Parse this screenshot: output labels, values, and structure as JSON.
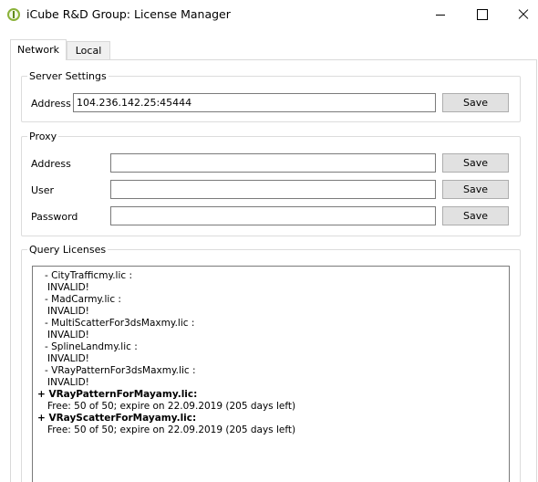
{
  "window": {
    "title": "iCube R&D Group: License Manager"
  },
  "tabs": [
    {
      "label": "Network",
      "active": true
    },
    {
      "label": "Local",
      "active": false
    }
  ],
  "server_settings": {
    "title": "Server Settings",
    "address_label": "Address",
    "address_value": "104.236.142.25:45444",
    "save_label": "Save"
  },
  "proxy": {
    "title": "Proxy",
    "address_label": "Address",
    "address_value": "",
    "user_label": "User",
    "user_value": "",
    "password_label": "Password",
    "password_value": "",
    "save_label": "Save"
  },
  "query_licenses": {
    "title": "Query Licenses",
    "entries": [
      {
        "prefix": "-",
        "name": "CityTrafficmy.lic :",
        "status": "INVALID!"
      },
      {
        "prefix": "-",
        "name": "MadCarmy.lic :",
        "status": "INVALID!"
      },
      {
        "prefix": "-",
        "name": "MultiScatterFor3dsMaxmy.lic :",
        "status": "INVALID!"
      },
      {
        "prefix": "-",
        "name": "SplineLandmy.lic :",
        "status": "INVALID!"
      },
      {
        "prefix": "-",
        "name": "VRayPatternFor3dsMaxmy.lic :",
        "status": "INVALID!"
      },
      {
        "prefix": "+",
        "name": "VRayPatternForMayamy.lic:",
        "status": "Free: 50 of 50; expire on 22.09.2019 (205 days left)"
      },
      {
        "prefix": "+",
        "name": "VRayScatterForMayamy.lic:",
        "status": "Free: 50 of 50; expire on 22.09.2019 (205 days left)"
      }
    ]
  }
}
